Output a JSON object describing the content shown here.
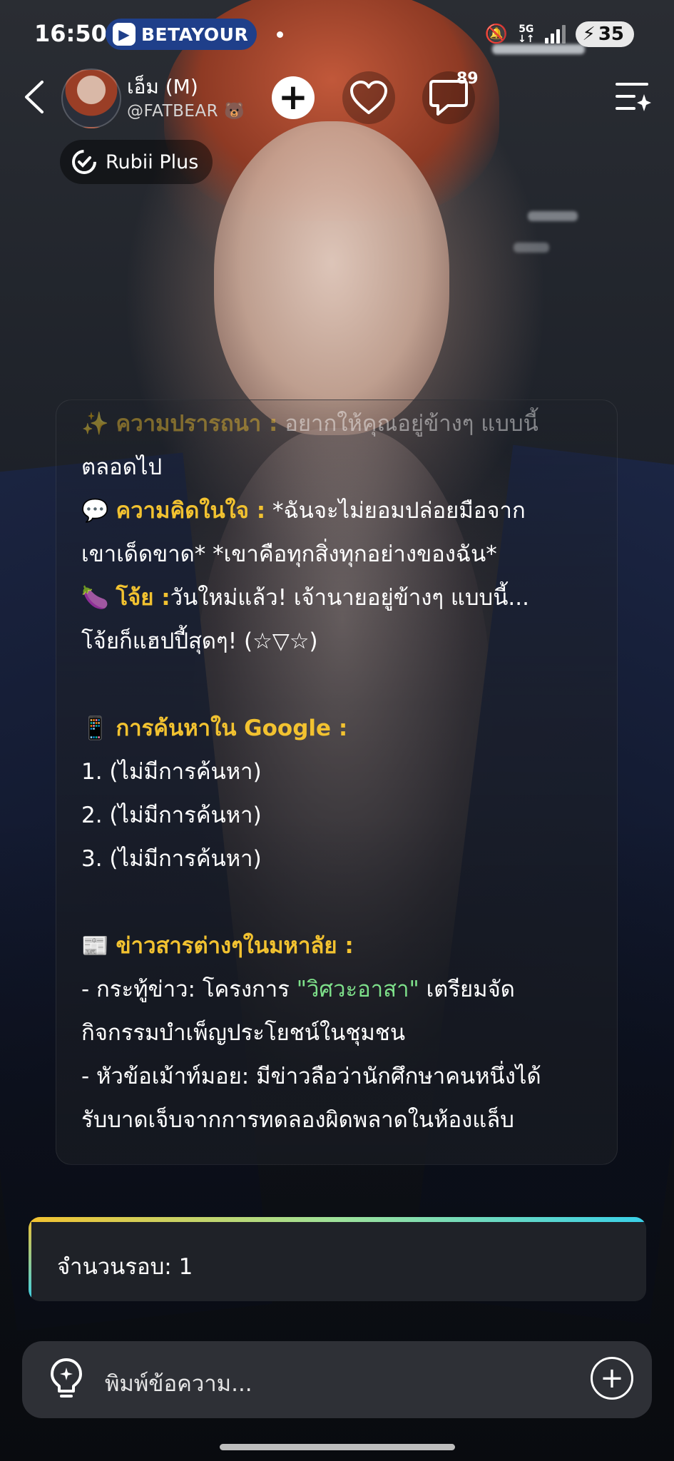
{
  "status_bar": {
    "time": "16:50",
    "app_name": "BETAYOUR",
    "network": "5G",
    "battery": "35"
  },
  "header": {
    "character_name": "เอ็ม (M)",
    "handle": "@FATBEAR 🐻",
    "comment_count": "89",
    "plus_label": "Rubii Plus"
  },
  "message": {
    "line1": {
      "emoji": "✨",
      "label": "ความปรารถนา :",
      "text": " อยากให้คุณอยู่ข้างๆ แบบนี้"
    },
    "line2": "ตลอดไป",
    "line3": {
      "emoji": "💬",
      "label": "ความคิดในใจ :",
      "text": " *ฉันจะไม่ยอมปล่อยมือจาก"
    },
    "line4": "เขาเด็ดขาด* *เขาคือทุกสิ่งทุกอย่างของฉัน*",
    "line5": {
      "emoji": "🍆",
      "label": "โจ้ย :",
      "text": "วันใหม่แล้ว! เจ้านายอยู่ข้างๆ แบบนี้..."
    },
    "line6": "โจ้ยก็แฮปปี้สุดๆ! (☆▽☆)",
    "google": {
      "emoji": "📱",
      "label": "การค้นหาใน Google :"
    },
    "search_items": [
      "1. (ไม่มีการค้นหา)",
      "2. (ไม่มีการค้นหา)",
      "3. (ไม่มีการค้นหา)"
    ],
    "news": {
      "emoji": "📰",
      "label": "ข่าวสารต่างๆในมหาลัย :"
    },
    "news1_a": "- กระทู้ข่าว: โครงการ ",
    "news1_quote": "\"วิศวะอาสา\"",
    "news1_b": " เตรียมจัด",
    "news1_line2": "กิจกรรมบำเพ็ญประโยชน์ในชุมชน",
    "news2_line1": "- หัวข้อเม้าท์มอย: มีข่าวลือว่านักศึกษาคนหนึ่งได้",
    "news2_line2": "รับบาดเจ็บจากการทดลองผิดพลาดในห้องแล็บ"
  },
  "round_counter": {
    "label": "จำนวนรอบ: 1"
  },
  "input": {
    "placeholder": "พิมพ์ข้อความ..."
  },
  "colors": {
    "label_yellow": "#f2c230",
    "quote_green": "#7ee08a",
    "accent_cyan": "#39d0e8"
  }
}
